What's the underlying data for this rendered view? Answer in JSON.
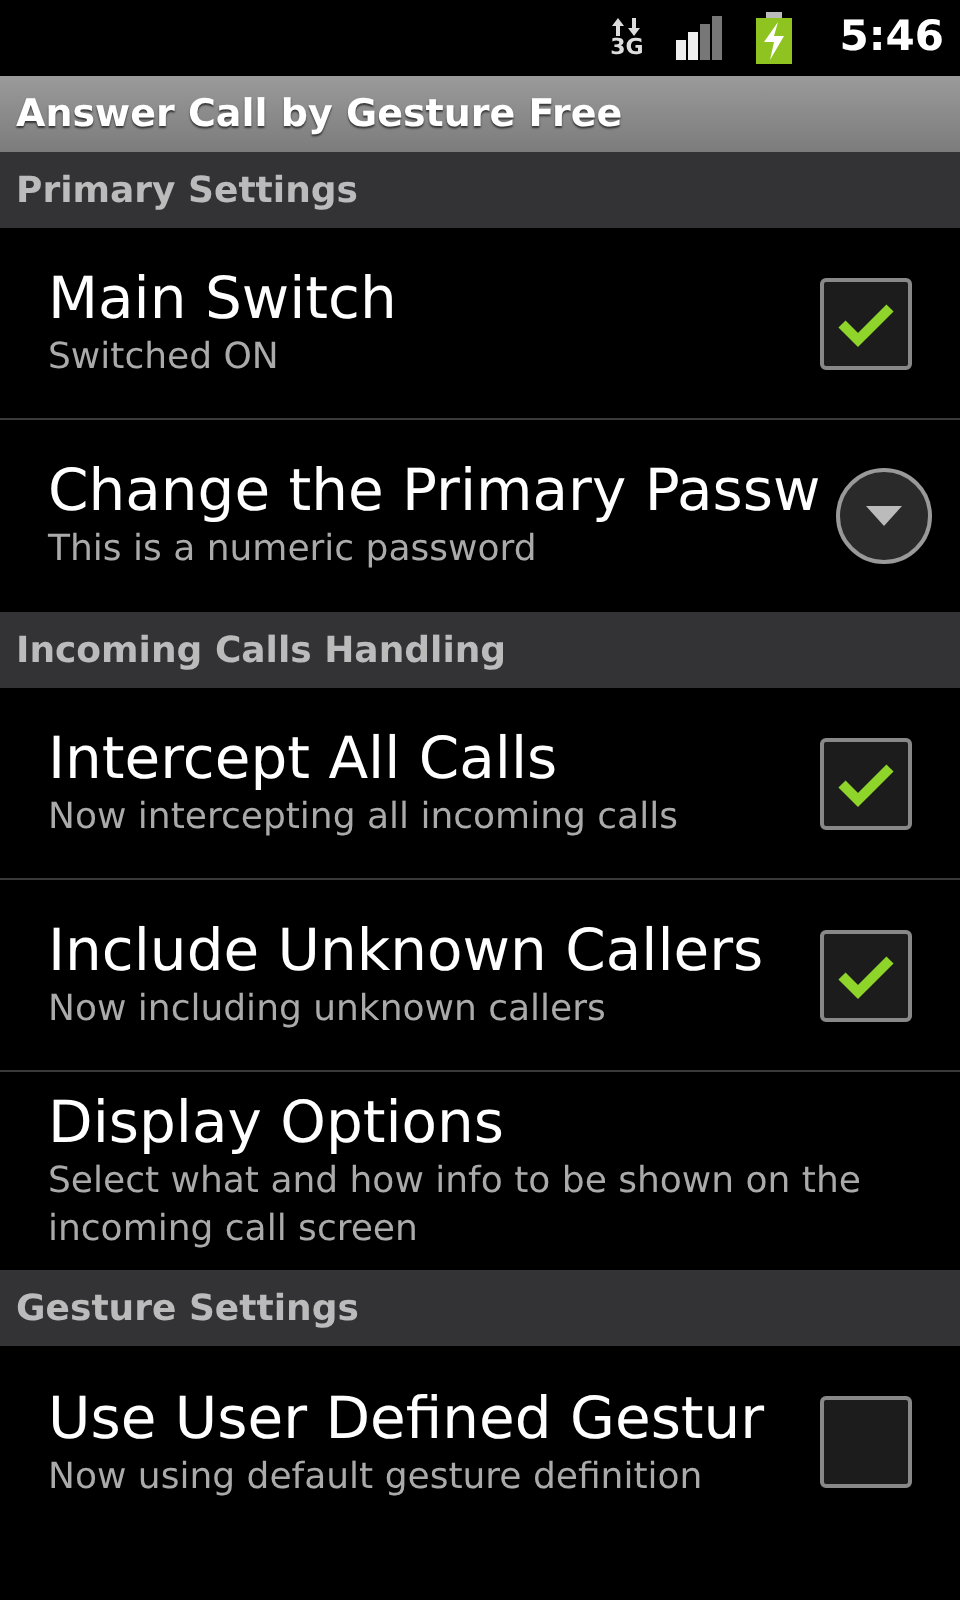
{
  "status_bar": {
    "network": "3G",
    "time": "5:46"
  },
  "window": {
    "title": "Answer Call by Gesture Free"
  },
  "sections": [
    {
      "header": "Primary Settings",
      "items": [
        {
          "kind": "checkbox",
          "title": "Main Switch",
          "summary": "Switched ON",
          "checked": true
        },
        {
          "kind": "dropdown",
          "title": "Change the Primary Passw",
          "summary": "This is a numeric password"
        }
      ]
    },
    {
      "header": "Incoming Calls Handling",
      "items": [
        {
          "kind": "checkbox",
          "title": "Intercept All Calls",
          "summary": "Now intercepting all incoming calls",
          "checked": true
        },
        {
          "kind": "checkbox",
          "title": "Include Unknown Callers",
          "summary": "Now including unknown callers",
          "checked": true
        },
        {
          "kind": "plain",
          "title": "Display Options",
          "summary": "Select what and how info to be shown on the incoming call screen"
        }
      ]
    },
    {
      "header": "Gesture Settings",
      "items": [
        {
          "kind": "checkbox",
          "title": "Use User Defined Gestur",
          "summary": "Now using default gesture definition",
          "checked": false
        }
      ]
    }
  ]
}
